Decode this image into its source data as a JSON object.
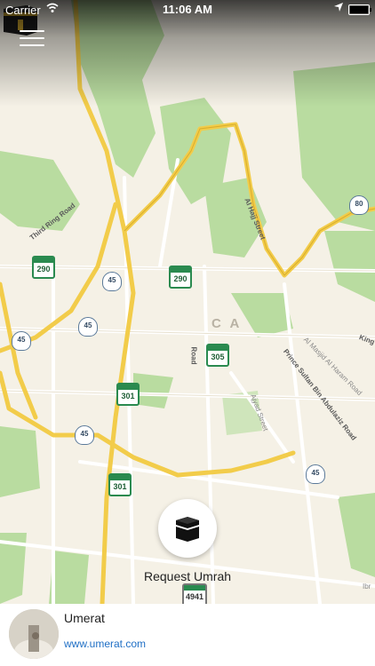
{
  "status_bar": {
    "carrier": "Carrier",
    "time": "11:06 AM"
  },
  "map": {
    "city_label": "C A",
    "road_labels": {
      "third_ring": "Third Ring Road",
      "al_hajj": "Al Hajj Street",
      "prince_sultan": "Prince Sultan Bin Abdulaziz Road",
      "al_masjid": "Al Masjid Al Haram Road",
      "ajyad": "Ajyad Street",
      "king": "King",
      "ibr": "Ibr",
      "road_frag": "Road"
    },
    "shields": [
      "290",
      "290",
      "305",
      "301",
      "301",
      "4941"
    ],
    "hw": [
      "45",
      "45",
      "45",
      "45",
      "45",
      "80"
    ]
  },
  "action": {
    "label": "Request Umrah"
  },
  "footer": {
    "name": "Umerat",
    "url": "www.umerat.com"
  },
  "colors": {
    "road_major": "#f2cc4a",
    "park": "#b9dca0",
    "link": "#1f6fc5"
  }
}
